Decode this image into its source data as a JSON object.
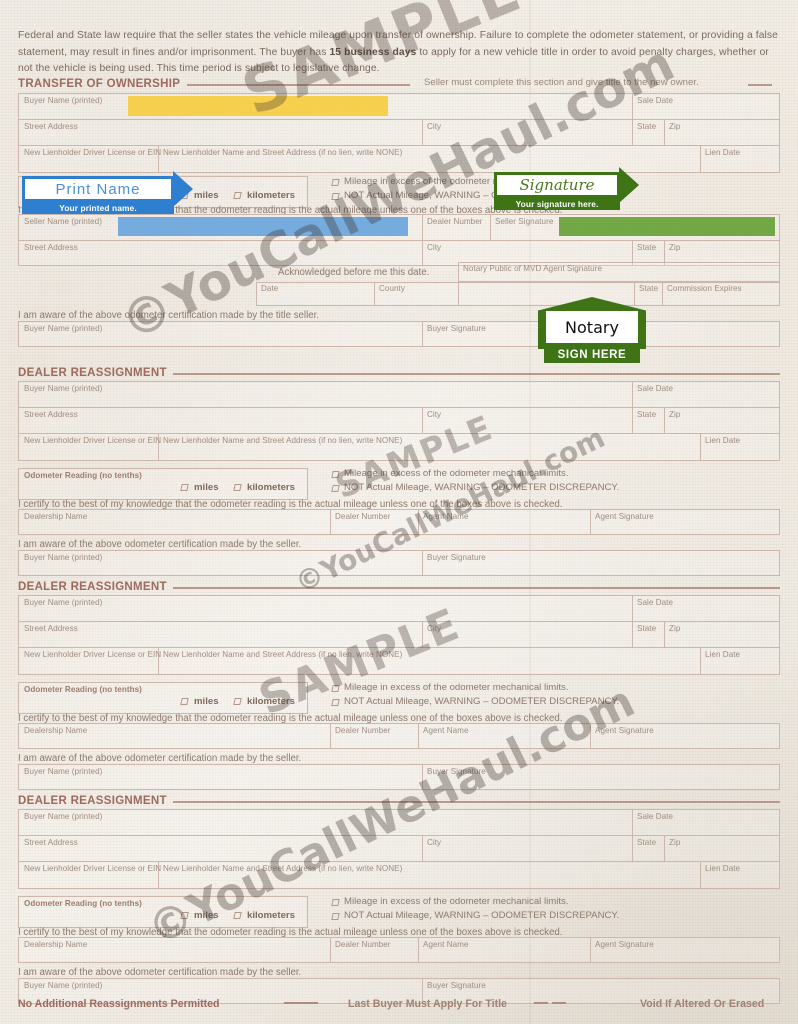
{
  "document": {
    "intro_lines": [
      "Federal and State law require that the seller states the vehicle mileage upon transfer of ownership. Failure to complete the odometer statement,",
      "or providing a false statement, may result in fines and/or imprisonment. The buyer has  to apply for a new vehicle title in order",
      "to avoid penalty charges, whether or not the vehicle is being used. This time period is subject to legislative change."
    ],
    "intro_emphasis": "15 business days",
    "footer": {
      "left": "No Additional Reassignments Permitted",
      "center": "Last Buyer Must Apply For Title",
      "right": "Void If Altered Or Erased"
    }
  },
  "watermarks": {
    "sample": "SAMPLE",
    "url": "©YouCallWeHaul.com"
  },
  "callouts": {
    "print_name": {
      "title": "Print Name",
      "subtitle": "Your printed name.",
      "color": "#2f7fd0"
    },
    "signature": {
      "title": "Signature",
      "subtitle": "Your signature here.",
      "color": "#3e7415"
    },
    "notary": {
      "title": "Notary",
      "subtitle": "SIGN HERE",
      "color": "#3e7415"
    }
  },
  "highlights": {
    "buyer_name": "#f7ce46",
    "seller_name": "#6fa8dc",
    "seller_signature": "#6aa33c"
  },
  "labels": {
    "buyer_name_printed": "Buyer Name (printed)",
    "sale_date": "Sale Date",
    "street_address": "Street Address",
    "city": "City",
    "state": "State",
    "zip": "Zip",
    "new_lienholder_dl": "New Lienholder Driver License or EIN",
    "new_lienholder_name": "New Lienholder Name and Street Address (if no lien, write NONE)",
    "lien_date": "Lien Date",
    "odometer_reading": "Odometer Reading (no tenths)",
    "miles": "miles",
    "kilometers": "kilometers",
    "excess_limits": "Mileage in excess of the odometer mechanical limits.",
    "not_actual": "NOT Actual Mileage, WARNING – ODOMETER DISCREPANCY.",
    "seller_name_printed": "Seller Name (printed)",
    "dealer_number": "Dealer Number",
    "seller_signature": "Seller Signature",
    "notary_agent_signature": "Notary Public of MVD Agent Signature",
    "acknowledged": "Acknowledged before me this date.",
    "date": "Date",
    "county": "County",
    "commission_expires": "Commission Expires",
    "buyer_signature": "Buyer Signature",
    "dealership_name": "Dealership Name",
    "agent_name": "Agent Name",
    "agent_signature": "Agent Signature"
  },
  "statements": {
    "certify_seller": "I certify to the best of my knowledge that the odometer reading is the actual mileage unless one of the boxes above is checked.",
    "aware_title_seller": "I am aware of the above odometer certification made by the title seller.",
    "aware_seller": "I am aware of the above odometer certification made by the seller."
  },
  "sections": [
    {
      "id": "transfer-of-ownership",
      "heading": "TRANSFER OF OWNERSHIP",
      "note": "Seller must complete this section and give title to the new owner."
    },
    {
      "id": "dealer-reassignment-1",
      "heading": "DEALER REASSIGNMENT",
      "note": ""
    },
    {
      "id": "dealer-reassignment-2",
      "heading": "DEALER REASSIGNMENT",
      "note": ""
    },
    {
      "id": "dealer-reassignment-3",
      "heading": "DEALER REASSIGNMENT",
      "note": ""
    }
  ]
}
